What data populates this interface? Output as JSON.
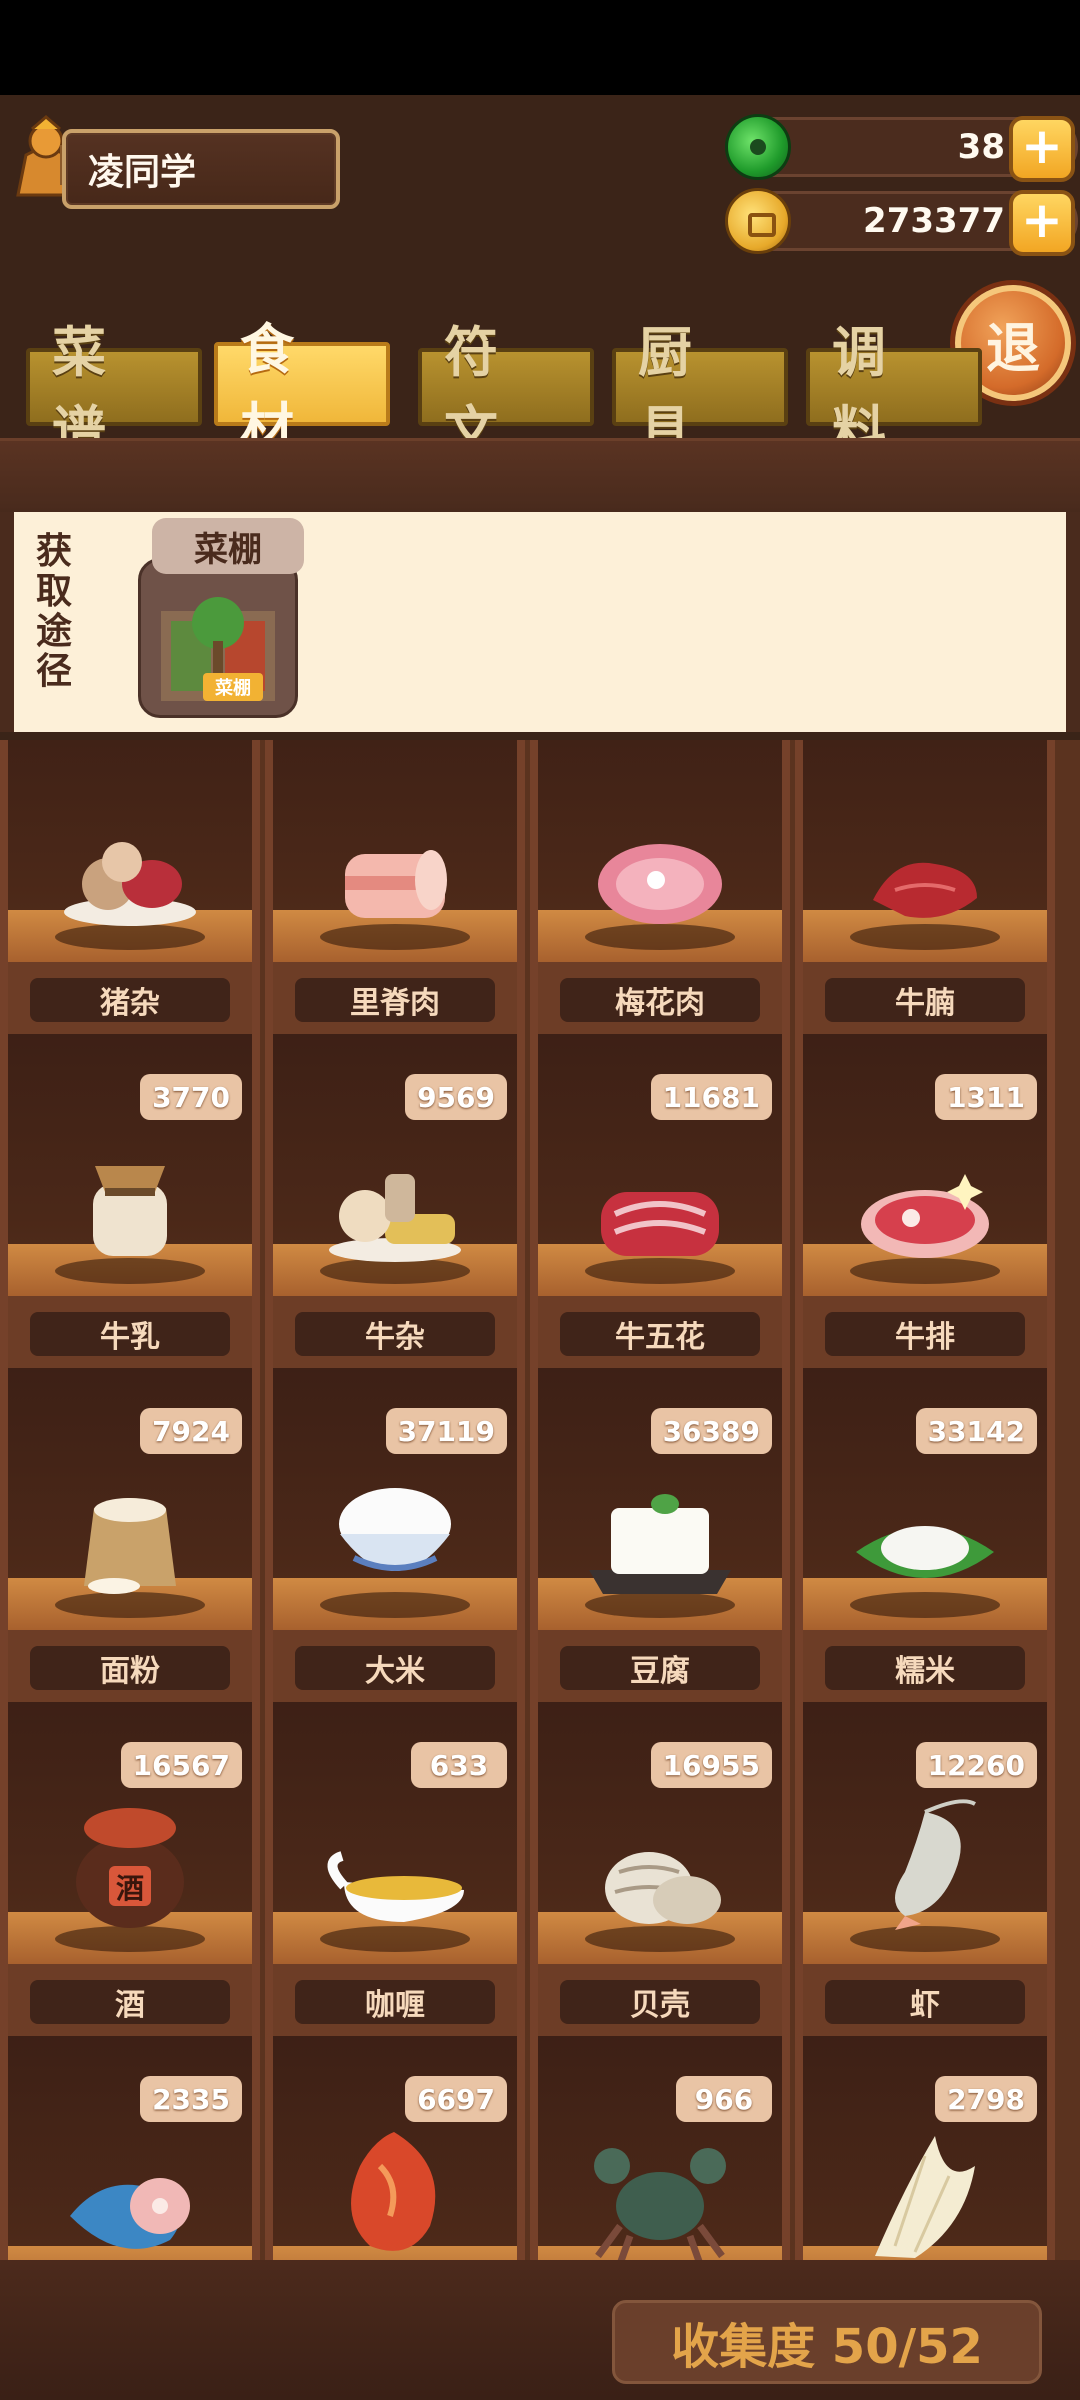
{
  "player": {
    "name": "凌同学"
  },
  "currency": {
    "jade": "38",
    "coins": "273377"
  },
  "exit_label": "退",
  "tabs": [
    "菜谱",
    "食材",
    "符文",
    "厨具",
    "调料"
  ],
  "active_tab": "食材",
  "source": {
    "label": "获取途径",
    "item_name": "菜棚",
    "item_tag": "菜棚"
  },
  "ingredients": [
    {
      "name": "猪杂",
      "count": ""
    },
    {
      "name": "里脊肉",
      "count": ""
    },
    {
      "name": "梅花肉",
      "count": ""
    },
    {
      "name": "牛腩",
      "count": ""
    },
    {
      "name": "牛乳",
      "count": "3770"
    },
    {
      "name": "牛杂",
      "count": "9569"
    },
    {
      "name": "牛五花",
      "count": "11681"
    },
    {
      "name": "牛排",
      "count": "1311"
    },
    {
      "name": "面粉",
      "count": "7924"
    },
    {
      "name": "大米",
      "count": "37119"
    },
    {
      "name": "豆腐",
      "count": "36389"
    },
    {
      "name": "糯米",
      "count": "33142"
    },
    {
      "name": "酒",
      "count": "16567"
    },
    {
      "name": "咖喱",
      "count": "633"
    },
    {
      "name": "贝壳",
      "count": "16955"
    },
    {
      "name": "虾",
      "count": "12260"
    },
    {
      "name": "",
      "count": "2335"
    },
    {
      "name": "",
      "count": "6697"
    },
    {
      "name": "",
      "count": "966"
    },
    {
      "name": "",
      "count": "2798"
    }
  ],
  "collection": {
    "label": "收集度 50/52"
  },
  "colors": {
    "accent": "#f2b233",
    "wood": "#5b331f",
    "panel": "#fdf0d8"
  }
}
